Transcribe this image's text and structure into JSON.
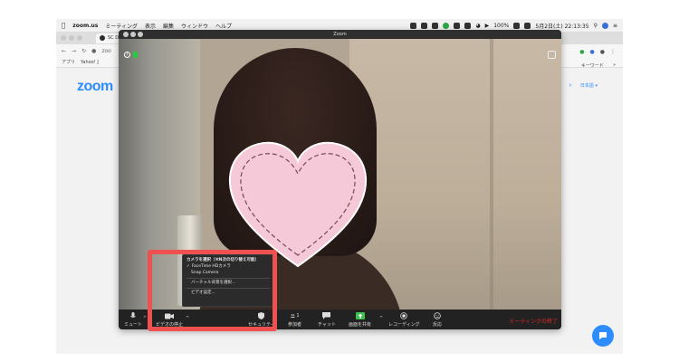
{
  "menubar": {
    "app": "zoom.us",
    "items": [
      "ミーティング",
      "表示",
      "編集",
      "ウィンドウ",
      "ヘルプ"
    ],
    "battery": "100%",
    "datetime": "5月2日(土) 22:13:35"
  },
  "browser": {
    "tab_title": "SC Dev",
    "address": "zoo",
    "bookmarks": [
      "アプリ",
      "Yahoo! J"
    ],
    "right_bookmark": "キーワード",
    "logo": "zoom",
    "nav_link": "ト",
    "language": "日本語 ▾"
  },
  "zoom_window": {
    "title": "Zoom",
    "toolbar": {
      "mute": "ミュート",
      "stop_video": "ビデオの停止",
      "security": "セキュリティ",
      "participants": "参加者",
      "participants_count": "1",
      "chat": "チャット",
      "share_screen": "画面を共有",
      "recording": "レコーディング",
      "reactions": "反応",
      "end_meeting": "ミーティングの終了"
    },
    "camera_menu": {
      "header": "カメラを選択（⌘N次の切り替え可能）",
      "items": [
        "FaceTime HDカメラ",
        "Snap Camera",
        "バーチャル背景を選択...",
        "ビデオ設定..."
      ]
    }
  },
  "colors": {
    "zoom_blue": "#2d8cff",
    "end_red": "#e02828",
    "highlight": "#ef5151",
    "heart_fill": "#f5c9d7"
  }
}
